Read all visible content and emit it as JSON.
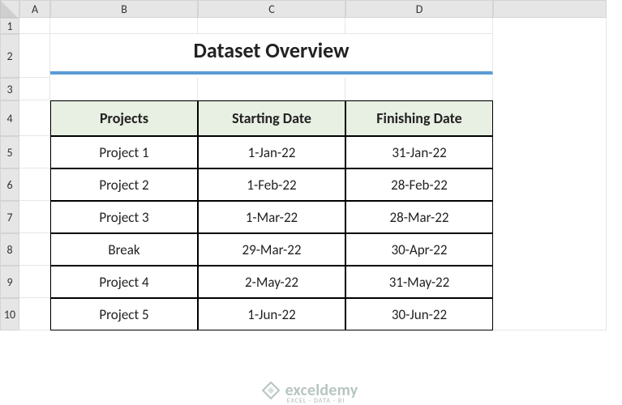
{
  "columns": [
    "A",
    "B",
    "C",
    "D"
  ],
  "rows": [
    "1",
    "2",
    "3",
    "4",
    "5",
    "6",
    "7",
    "8",
    "9",
    "10"
  ],
  "title": "Dataset Overview",
  "table": {
    "headers": [
      "Projects",
      "Starting Date",
      "Finishing Date"
    ],
    "rows": [
      {
        "project": "Project 1",
        "start": "1-Jan-22",
        "finish": "31-Jan-22"
      },
      {
        "project": "Project 2",
        "start": "1-Feb-22",
        "finish": "28-Feb-22"
      },
      {
        "project": "Project 3",
        "start": "1-Mar-22",
        "finish": "28-Mar-22"
      },
      {
        "project": "Break",
        "start": "29-Mar-22",
        "finish": "30-Apr-22"
      },
      {
        "project": "Project 4",
        "start": "2-May-22",
        "finish": "31-May-22"
      },
      {
        "project": "Project 5",
        "start": "1-Jun-22",
        "finish": "30-Jun-22"
      }
    ]
  },
  "watermark": {
    "brand": "exceldemy",
    "tagline": "EXCEL · DATA · BI"
  }
}
